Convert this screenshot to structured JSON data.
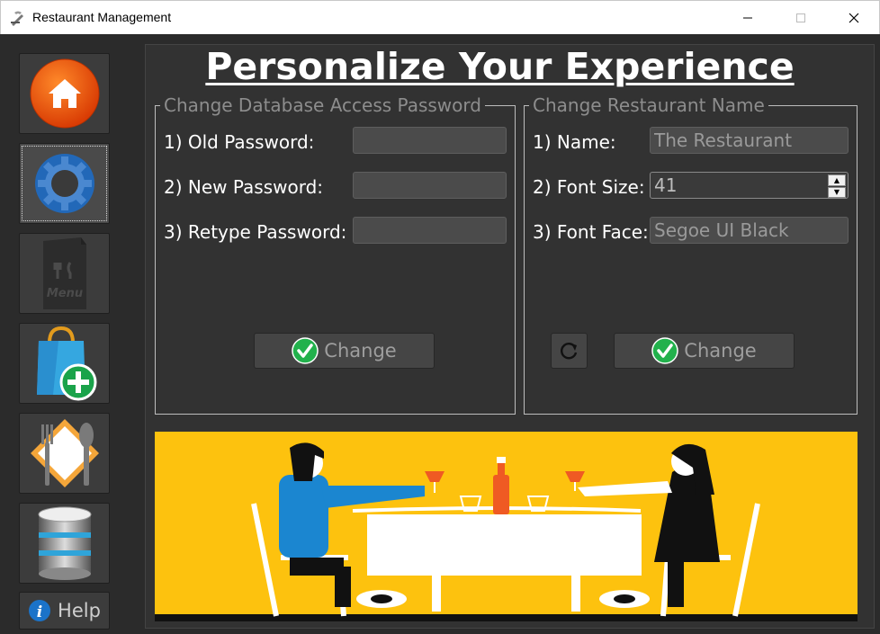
{
  "window": {
    "title": "Restaurant Management"
  },
  "sidebar": {
    "items": [
      {
        "name": "home",
        "icon": "home-icon"
      },
      {
        "name": "settings",
        "icon": "gear-icon"
      },
      {
        "name": "menu",
        "icon": "menu-book-icon",
        "icon_text": "Menu"
      },
      {
        "name": "add-order",
        "icon": "shopping-bag-add-icon"
      },
      {
        "name": "dining",
        "icon": "plate-cutlery-icon"
      },
      {
        "name": "database",
        "icon": "database-icon"
      }
    ],
    "help_label": "Help"
  },
  "page": {
    "title": "Personalize Your Experience"
  },
  "password_group": {
    "legend": "Change Database Access Password",
    "old_label": "1) Old Password:",
    "new_label": "2) New Password:",
    "retype_label": "3) Retype Password:",
    "old_value": "",
    "new_value": "",
    "retype_value": "",
    "change_label": "Change"
  },
  "name_group": {
    "legend": "Change Restaurant Name",
    "name_label": "1) Name:",
    "name_value": "The Restaurant",
    "font_size_label": "2) Font Size:",
    "font_size_value": "41",
    "font_face_label": "3) Font Face:",
    "font_face_value": "Segoe UI Black",
    "change_label": "Change"
  },
  "colors": {
    "banner_bg": "#fdc20e",
    "check_green": "#22b14c",
    "accent_blue": "#1b73c9"
  }
}
